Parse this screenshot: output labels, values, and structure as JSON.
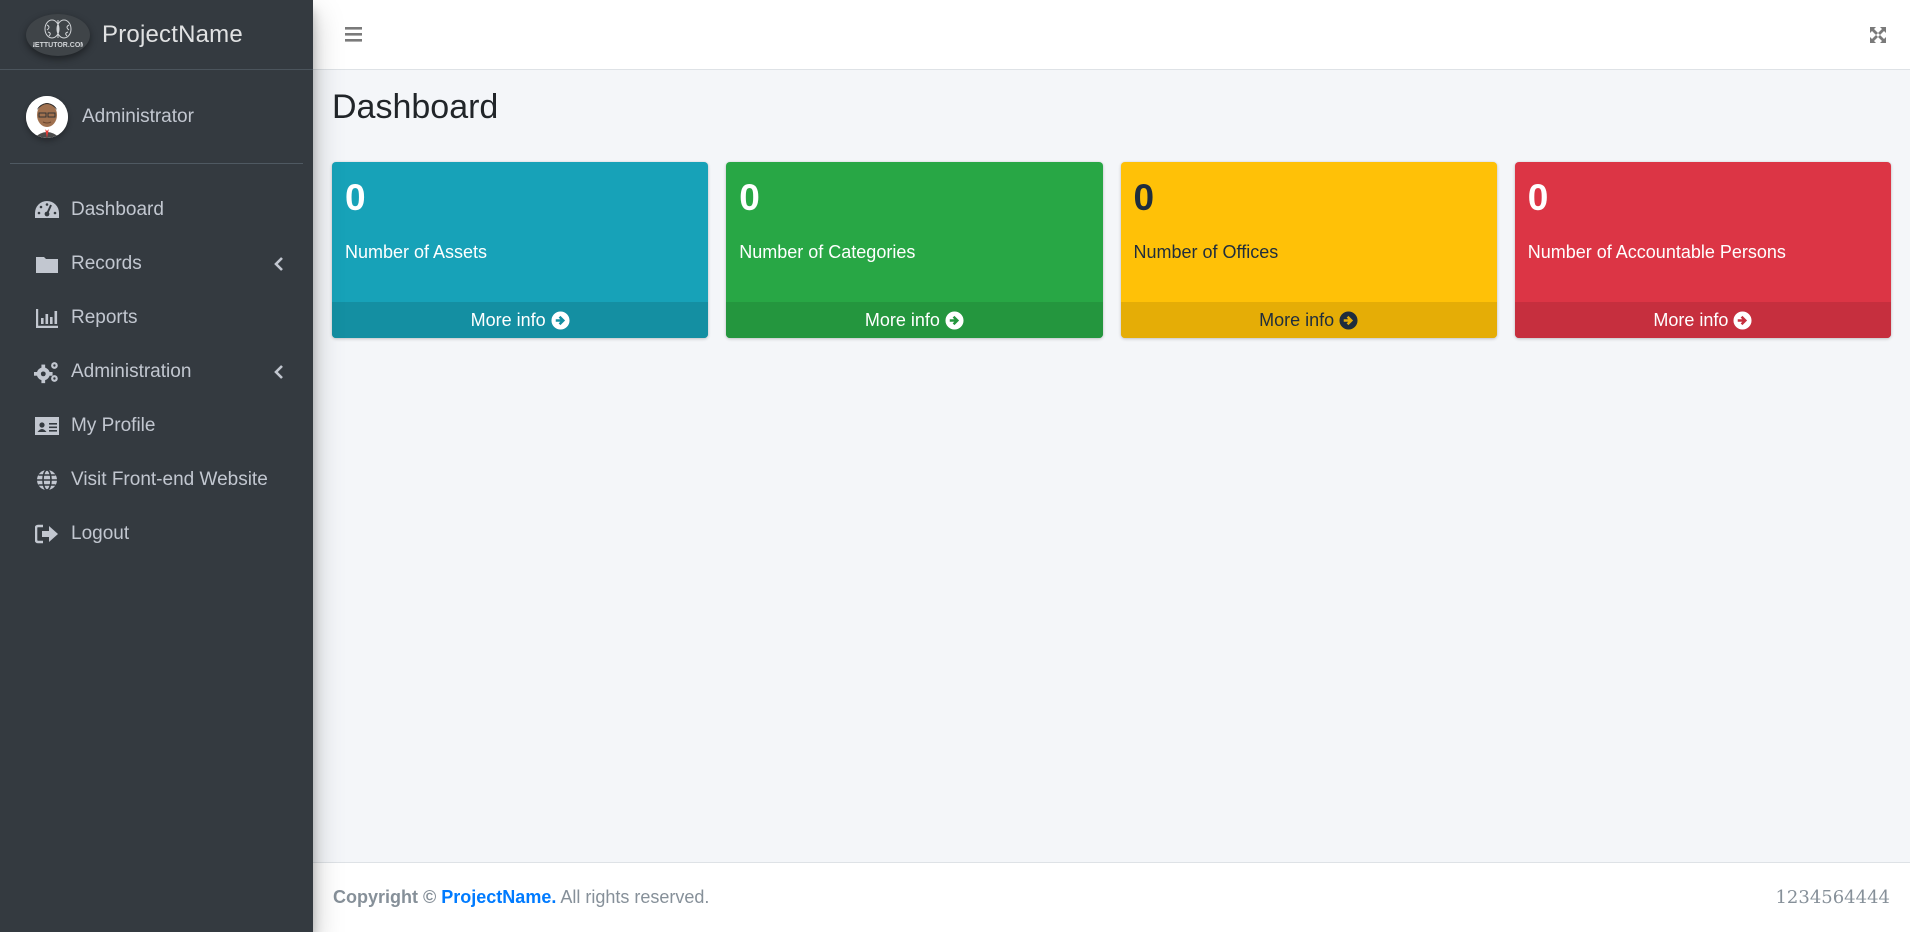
{
  "brand": {
    "name": "ProjectName",
    "logo": "nettutor-brain-logo",
    "logo_text": "NETTUTOR.COM"
  },
  "user": {
    "name": "Administrator",
    "avatar": "user-avatar"
  },
  "nav": {
    "items": [
      {
        "label": "Dashboard",
        "icon": "tachometer-icon",
        "has_submenu": false
      },
      {
        "label": "Records",
        "icon": "folder-icon",
        "has_submenu": true
      },
      {
        "label": "Reports",
        "icon": "bar-chart-icon",
        "has_submenu": false
      },
      {
        "label": "Administration",
        "icon": "cogs-icon",
        "has_submenu": true
      },
      {
        "label": "My Profile",
        "icon": "id-card-icon",
        "has_submenu": false
      },
      {
        "label": "Visit Front-end Website",
        "icon": "globe-icon",
        "has_submenu": false
      },
      {
        "label": "Logout",
        "icon": "sign-out-icon",
        "has_submenu": false
      }
    ]
  },
  "header": {
    "menu_icon": "hamburger-icon",
    "fullscreen_icon": "expand-icon"
  },
  "page": {
    "title": "Dashboard"
  },
  "cards": [
    {
      "count": "0",
      "label": "Number of Assets",
      "link": "More info",
      "color": "#17a2b8",
      "footer_color": "#148fa2",
      "text_color": "#ffffff"
    },
    {
      "count": "0",
      "label": "Number of Categories",
      "link": "More info",
      "color": "#28a745",
      "footer_color": "#24963e",
      "text_color": "#ffffff"
    },
    {
      "count": "0",
      "label": "Number of Offices",
      "link": "More info",
      "color": "#ffc107",
      "footer_color": "#e5ad06",
      "text_color": "#1f2d3d"
    },
    {
      "count": "0",
      "label": "Number of Accountable Persons",
      "link": "More info",
      "color": "#dc3545",
      "footer_color": "#c62f3e",
      "text_color": "#ffffff"
    }
  ],
  "footer": {
    "copyright_prefix": "Copyright ©",
    "project_link": "ProjectName.",
    "rights": "All rights reserved.",
    "right_text": "1234564444"
  }
}
